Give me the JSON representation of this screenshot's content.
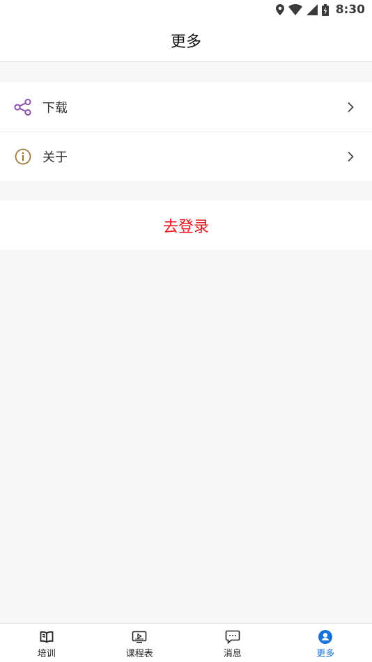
{
  "status_bar": {
    "time": "8:30"
  },
  "header": {
    "title": "更多"
  },
  "menu": {
    "items": [
      {
        "label": "下载",
        "icon": "share-icon"
      },
      {
        "label": "关于",
        "icon": "info-icon"
      }
    ]
  },
  "login": {
    "label": "去登录"
  },
  "tab_bar": {
    "tabs": [
      {
        "label": "培训",
        "icon": "book-icon"
      },
      {
        "label": "课程表",
        "icon": "video-screen-icon"
      },
      {
        "label": "消息",
        "icon": "chat-bubble-icon"
      },
      {
        "label": "更多",
        "icon": "user-circle-icon"
      }
    ],
    "active_index": 3
  },
  "colors": {
    "accent_blue": "#1a73d9",
    "login_red": "#e8141c",
    "share_icon_purple": "#8b52a8",
    "info_icon_brown": "#9c7a3c",
    "background": "#f7f7f7"
  }
}
